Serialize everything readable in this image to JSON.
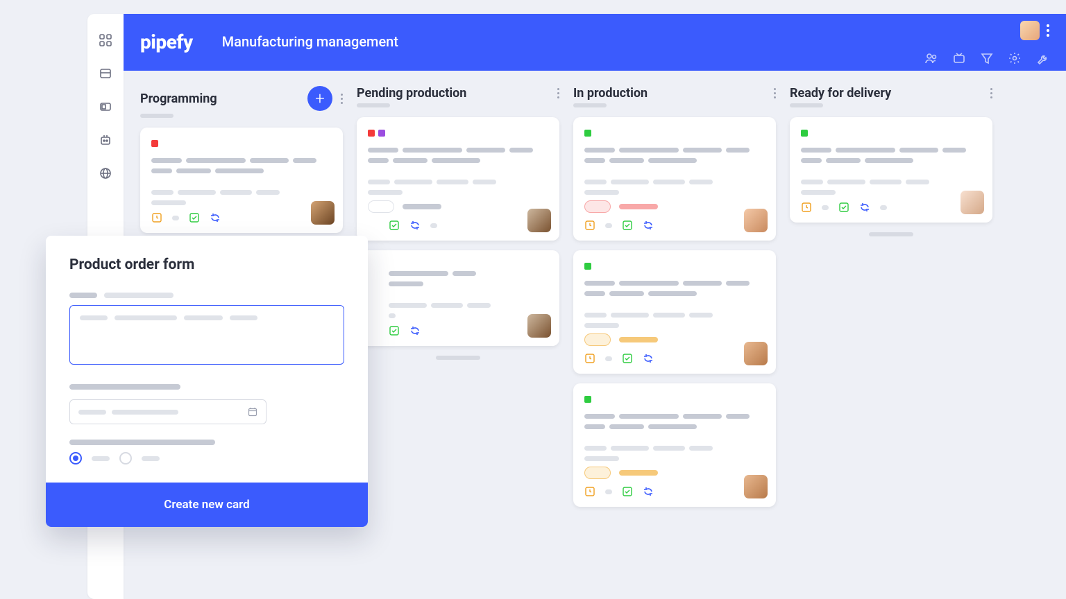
{
  "app": {
    "logo_text": "pipefy",
    "board_title": "Manufacturing management"
  },
  "header_actions": {
    "user_avatar": "current-user"
  },
  "header_toolbar_icons": [
    "members",
    "inbox",
    "filter",
    "settings",
    "tools"
  ],
  "sidebar_icons": [
    "dashboard",
    "list-view",
    "card-view",
    "automation",
    "globe"
  ],
  "columns": [
    {
      "title": "Programming",
      "has_add": true,
      "cards": [
        {
          "tags": [
            "red"
          ],
          "avatar": "av1",
          "meta_colors": [
            "orange",
            "green",
            "blue"
          ]
        }
      ]
    },
    {
      "title": "Pending production",
      "has_add": false,
      "cards": [
        {
          "tags": [
            "red",
            "purple"
          ],
          "avatar": "av2",
          "badge_style": "grey",
          "meta_colors": [
            "green",
            "blue"
          ]
        },
        {
          "tags": [],
          "avatar": "av2",
          "meta_colors": [
            "green",
            "blue"
          ],
          "truncated": true
        }
      ]
    },
    {
      "title": "In production",
      "has_add": false,
      "cards": [
        {
          "tags": [
            "green"
          ],
          "avatar": "av3",
          "badge_style": "pink",
          "meta_colors": [
            "orange",
            "green",
            "blue"
          ]
        },
        {
          "tags": [
            "green"
          ],
          "avatar": "av4",
          "badge_style": "orange",
          "meta_colors": [
            "orange",
            "green",
            "blue"
          ]
        },
        {
          "tags": [
            "green"
          ],
          "avatar": "av4",
          "badge_style": "orange",
          "meta_colors": [
            "orange",
            "green",
            "blue"
          ]
        }
      ]
    },
    {
      "title": "Ready for delivery",
      "has_add": false,
      "cards": [
        {
          "tags": [
            "green"
          ],
          "avatar": "av5",
          "meta_colors": [
            "orange",
            "green",
            "blue"
          ]
        }
      ]
    }
  ],
  "form": {
    "title": "Product order form",
    "submit_label": "Create new card"
  }
}
